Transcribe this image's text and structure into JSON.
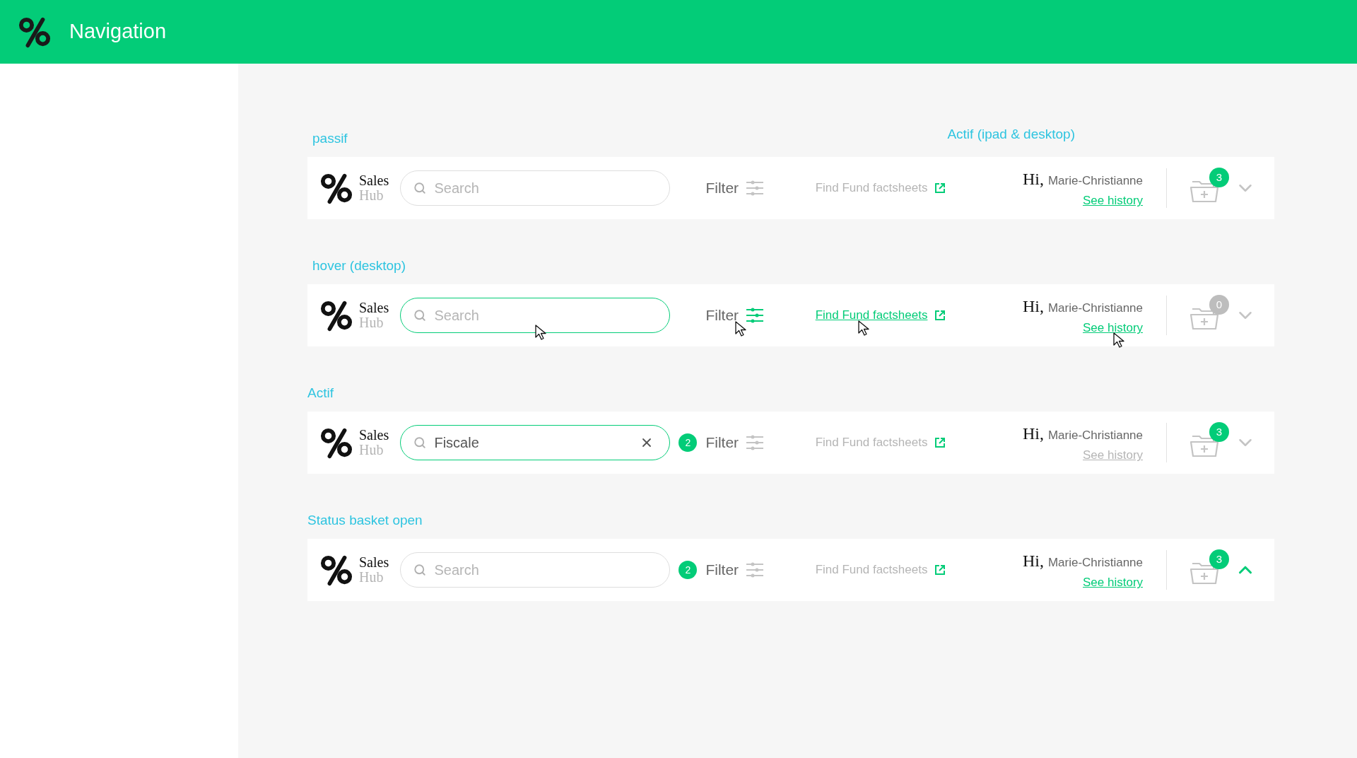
{
  "header": {
    "title": "Navigation"
  },
  "side_label": "Actif (ipad & desktop)",
  "rows": [
    {
      "label": "passif",
      "brand": {
        "line1": "Sales",
        "line2": "Hub"
      },
      "search": {
        "placeholder": "Search",
        "hovered": false,
        "focused": false
      },
      "filter": {
        "label": "Filter",
        "hovered": false
      },
      "factsheets": {
        "label": "Find Fund factsheets",
        "hovered": false
      },
      "greeting": {
        "hi": "Hi,",
        "name": "Marie-Christianne"
      },
      "history": {
        "label": "See history",
        "hovered": false,
        "muted": false
      },
      "basket": {
        "count": "3",
        "color": "#03cc78",
        "expanded": false
      }
    },
    {
      "label": "hover (desktop)",
      "brand": {
        "line1": "Sales",
        "line2": "Hub"
      },
      "search": {
        "placeholder": "Search",
        "hovered": true,
        "focused": false
      },
      "filter": {
        "label": "Filter",
        "hovered": true
      },
      "factsheets": {
        "label": "Find Fund factsheets",
        "hovered": true
      },
      "greeting": {
        "hi": "Hi,",
        "name": "Marie-Christianne"
      },
      "history": {
        "label": "See history",
        "hovered": true,
        "muted": false
      },
      "basket": {
        "count": "0",
        "color": "#bdbdbd",
        "expanded": false
      }
    },
    {
      "label": "Actif",
      "brand": {
        "line1": "Sales",
        "line2": "Hub"
      },
      "search": {
        "value": "Fiscale",
        "hovered": false,
        "focused": true
      },
      "filter": {
        "label": "Filter",
        "count": "2",
        "hovered": false
      },
      "factsheets": {
        "label": "Find Fund factsheets",
        "hovered": false
      },
      "greeting": {
        "hi": "Hi,",
        "name": "Marie-Christianne"
      },
      "history": {
        "label": "See history",
        "hovered": false,
        "muted": true
      },
      "basket": {
        "count": "3",
        "color": "#03cc78",
        "expanded": false
      }
    },
    {
      "label": "Status basket open",
      "brand": {
        "line1": "Sales",
        "line2": "Hub"
      },
      "search": {
        "placeholder": "Search",
        "hovered": false,
        "focused": false
      },
      "filter": {
        "label": "Filter",
        "count": "2",
        "hovered": false
      },
      "factsheets": {
        "label": "Find Fund factsheets",
        "hovered": false
      },
      "greeting": {
        "hi": "Hi,",
        "name": "Marie-Christianne"
      },
      "history": {
        "label": "See history",
        "hovered": false,
        "muted": false
      },
      "basket": {
        "count": "3",
        "color": "#03cc78",
        "expanded": true
      }
    }
  ]
}
